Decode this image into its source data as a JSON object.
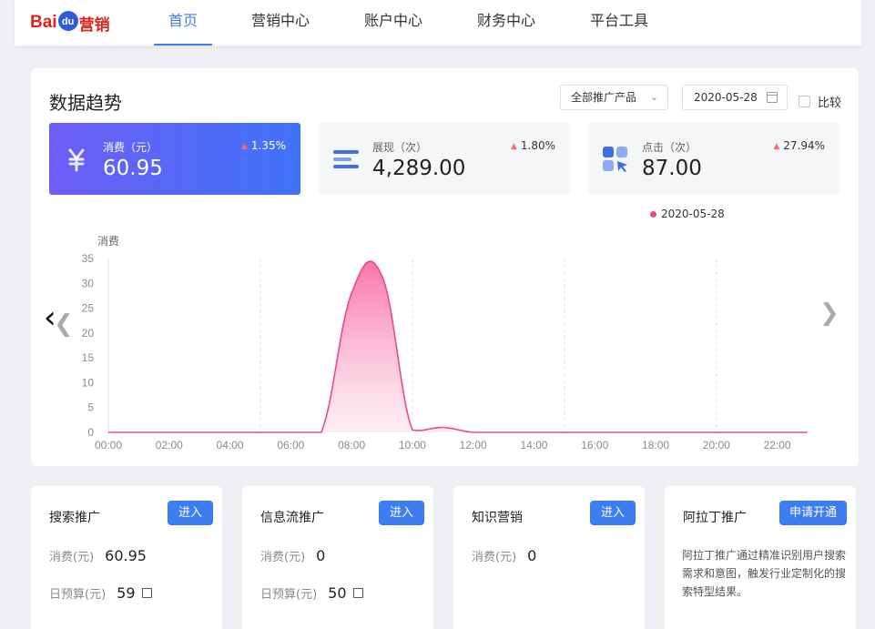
{
  "logo": {
    "part1": "Bai",
    "part2": "du",
    "part3": "营销"
  },
  "nav": [
    {
      "label": "首页",
      "active": true
    },
    {
      "label": "营销中心",
      "active": false
    },
    {
      "label": "账户中心",
      "active": false
    },
    {
      "label": "财务中心",
      "active": false
    },
    {
      "label": "平台工具",
      "active": false
    }
  ],
  "trend": {
    "title": "数据趋势",
    "product_select": "全部推广产品",
    "date": "2020-05-28",
    "compare_label": "比较",
    "metrics": [
      {
        "label": "消费（元）",
        "value": "60.95",
        "change": "1.35%",
        "icon": "yen-icon",
        "active": true
      },
      {
        "label": "展现（次）",
        "value": "4,289.00",
        "change": "1.80%",
        "icon": "impression-bars-icon",
        "active": false
      },
      {
        "label": "点击（次）",
        "value": "87.00",
        "change": "27.94%",
        "icon": "click-grid-icon",
        "active": false
      }
    ]
  },
  "chart_data": {
    "type": "area",
    "title": "",
    "ylabel": "消费",
    "xlabel": "",
    "legend": [
      "2020-05-28"
    ],
    "legend_position": "top-right",
    "ylim": [
      0,
      35
    ],
    "yticks": [
      "0",
      "5",
      "10",
      "15",
      "20",
      "25",
      "30",
      "35"
    ],
    "xticks": [
      "00:00",
      "02:00",
      "04:00",
      "06:00",
      "08:00",
      "10:00",
      "12:00",
      "14:00",
      "16:00",
      "18:00",
      "20:00",
      "22:00"
    ],
    "series": [
      {
        "name": "2020-05-28",
        "color": "#f0478c",
        "x": [
          "00:00",
          "01:00",
          "02:00",
          "03:00",
          "04:00",
          "05:00",
          "06:00",
          "07:00",
          "08:00",
          "09:00",
          "10:00",
          "11:00",
          "12:00",
          "13:00",
          "14:00",
          "15:00",
          "16:00",
          "17:00",
          "18:00",
          "19:00",
          "20:00",
          "21:00",
          "22:00",
          "23:00"
        ],
        "values": [
          0,
          0,
          0,
          0,
          0,
          0,
          0,
          0,
          28,
          31.5,
          0.5,
          1,
          0,
          0,
          0,
          0,
          0,
          0,
          0,
          0,
          0,
          0,
          0,
          0
        ]
      }
    ]
  },
  "products": [
    {
      "title": "搜索推广",
      "button": "进入",
      "spend_label": "消费(元)",
      "spend": "60.95",
      "budget_label": "日预算(元)",
      "budget": "59"
    },
    {
      "title": "信息流推广",
      "button": "进入",
      "spend_label": "消费(元)",
      "spend": "0",
      "budget_label": "日预算(元)",
      "budget": "50"
    },
    {
      "title": "知识营销",
      "button": "进入",
      "spend_label": "消费(元)",
      "spend": "0"
    },
    {
      "title": "阿拉丁推广",
      "button": "申请开通",
      "desc": "阿拉丁推广通过精准识别用户搜索需求和意图，触发行业定制化的搜索特型结果。"
    }
  ]
}
